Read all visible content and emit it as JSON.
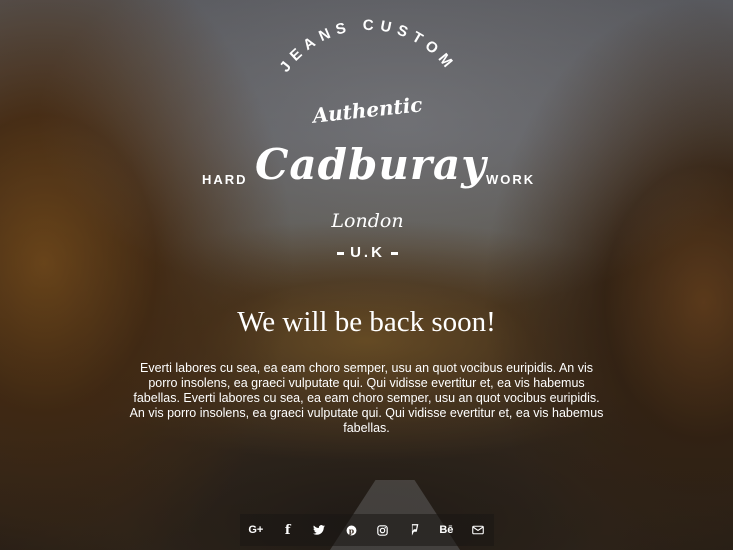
{
  "logo": {
    "arc_text": "JEANS CUSTOM",
    "script_word": "Authentic",
    "brand": "Cadburay",
    "left_word": "HARD",
    "right_word": "WORK",
    "city": "London",
    "country": "U.K"
  },
  "headline": "We will be back soon!",
  "body": "Everti labores cu sea, ea eam choro semper, usu an quot vocibus euripidis. An vis porro insolens, ea graeci vulputate qui. Qui vidisse evertitur et, ea vis habemus fabellas. Everti labores cu sea, ea eam choro semper, usu an quot vocibus euripidis. An vis porro insolens, ea graeci vulputate qui. Qui vidisse evertitur et, ea vis habemus fabellas.",
  "social": [
    {
      "icon": "google-plus-icon",
      "glyph": "G+"
    },
    {
      "icon": "facebook-icon",
      "glyph": "f"
    },
    {
      "icon": "twitter-icon",
      "glyph": ""
    },
    {
      "icon": "pinterest-icon",
      "glyph": ""
    },
    {
      "icon": "instagram-icon",
      "glyph": ""
    },
    {
      "icon": "foursquare-icon",
      "glyph": ""
    },
    {
      "icon": "behance-icon",
      "glyph": "Bē"
    },
    {
      "icon": "email-icon",
      "glyph": ""
    }
  ]
}
